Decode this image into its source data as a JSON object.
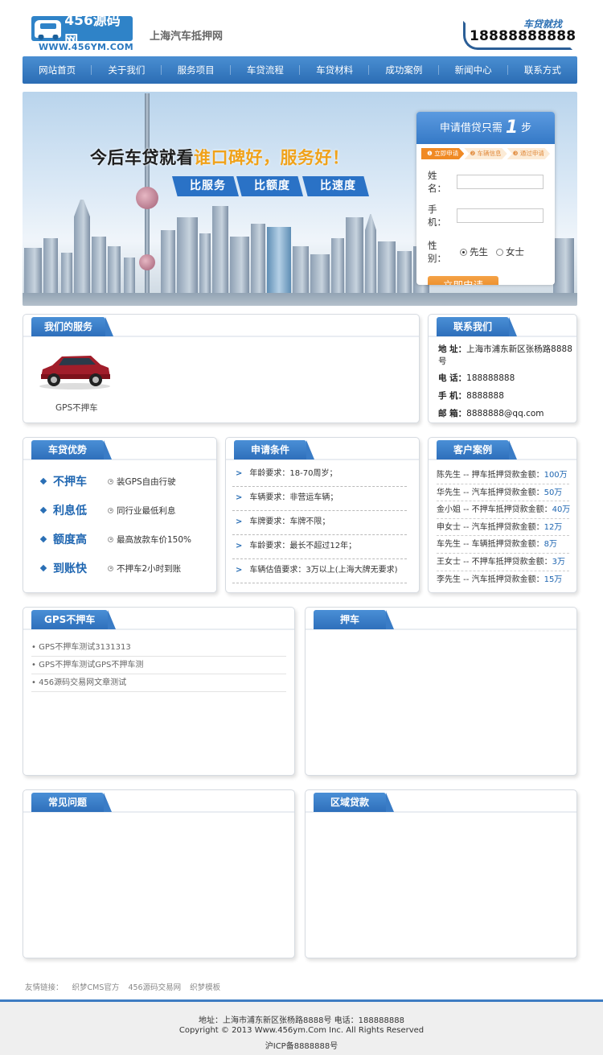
{
  "header": {
    "logo_text": "456源码网",
    "logo_url": "WWW.456YM.COM",
    "site_title": "上海汽车抵押网",
    "hotline_label": "车贷就找",
    "hotline_number": "18888888888"
  },
  "nav": {
    "items": [
      "网站首页",
      "关于我们",
      "服务项目",
      "车贷流程",
      "车贷材料",
      "成功案例",
      "新闻中心",
      "联系方式"
    ]
  },
  "banner": {
    "slogan_prefix": "今后车贷就看",
    "slogan_highlight": "谁口碑好，服务好！",
    "tags": [
      "比服务",
      "比额度",
      "比速度"
    ]
  },
  "apply_form": {
    "title_prefix": "申请借贷只需",
    "title_number": "1",
    "title_suffix": "步",
    "steps": [
      "❶ 立即申请",
      "❷ 车辆信息",
      "❸ 通过申请"
    ],
    "name_label": "姓 名：",
    "phone_label": "手 机：",
    "gender_label": "性 别：",
    "gender_male": "先生",
    "gender_female": "女士",
    "submit_label": "立即申请"
  },
  "services": {
    "title": "我们的服务",
    "item_label": "GPS不押车"
  },
  "contact": {
    "title": "联系我们",
    "address_label": "地 址：",
    "address_value": "上海市浦东新区张杨路8888号",
    "tel_label": "电 话：",
    "tel_value": "188888888",
    "mobile_label": "手 机：",
    "mobile_value": "8888888",
    "email_label": "邮 箱：",
    "email_value": "8888888@qq.com"
  },
  "advantages": {
    "title": "车贷优势",
    "rows": [
      {
        "key": "不押车",
        "value": "装GPS自由行驶"
      },
      {
        "key": "利息低",
        "value": "同行业最低利息"
      },
      {
        "key": "额度高",
        "value": "最高放款车价150%"
      },
      {
        "key": "到账快",
        "value": "不押车2小时到账"
      }
    ]
  },
  "conditions": {
    "title": "申请条件",
    "rows": [
      "年龄要求：18-70周岁；",
      "车辆要求：非营运车辆；",
      "车牌要求：车牌不限；",
      "车龄要求：最长不超过12年；",
      "车辆估值要求：3万以上(上海大牌无要求)"
    ]
  },
  "cases": {
    "title": "客户案例",
    "rows": [
      {
        "text": "陈先生 -- 押车抵押贷款金额：",
        "amount": "100万"
      },
      {
        "text": "华先生 -- 汽车抵押贷款金额：",
        "amount": "50万"
      },
      {
        "text": "金小姐 -- 不押车抵押贷款金额：",
        "amount": "40万"
      },
      {
        "text": "申女士 -- 汽车抵押贷款金额：",
        "amount": "12万"
      },
      {
        "text": "车先生 -- 车辆抵押贷款金额：",
        "amount": "8万"
      },
      {
        "text": "王女士 -- 不押车抵押贷款金额：",
        "amount": "3万"
      },
      {
        "text": "李先生 -- 汽车抵押贷款金额：",
        "amount": "15万"
      }
    ]
  },
  "gps_news": {
    "title": "GPS不押车",
    "items": [
      "• GPS不押车测试3131313",
      "• GPS不押车测试GPS不押车测",
      "• 456源码交易网文章测试"
    ]
  },
  "mortgage": {
    "title": "押车"
  },
  "faq": {
    "title": "常见问题"
  },
  "region": {
    "title": "区域贷款"
  },
  "footer": {
    "links_label": "友情链接：",
    "links": [
      "织梦CMS官方",
      "456源码交易网",
      "织梦模板"
    ],
    "address_line": "地址：上海市浦东新区张杨路8888号  电话：188888888",
    "copyright": "Copyright © 2013 Www.456ym.Com Inc. All Rights Reserved",
    "icp": "沪ICP备8888888号"
  },
  "colors": {
    "brand_blue": "#2f83c8",
    "nav_blue": "#3a7cc6",
    "accent_orange": "#f0a21a",
    "submit_orange": "#e47d15"
  }
}
